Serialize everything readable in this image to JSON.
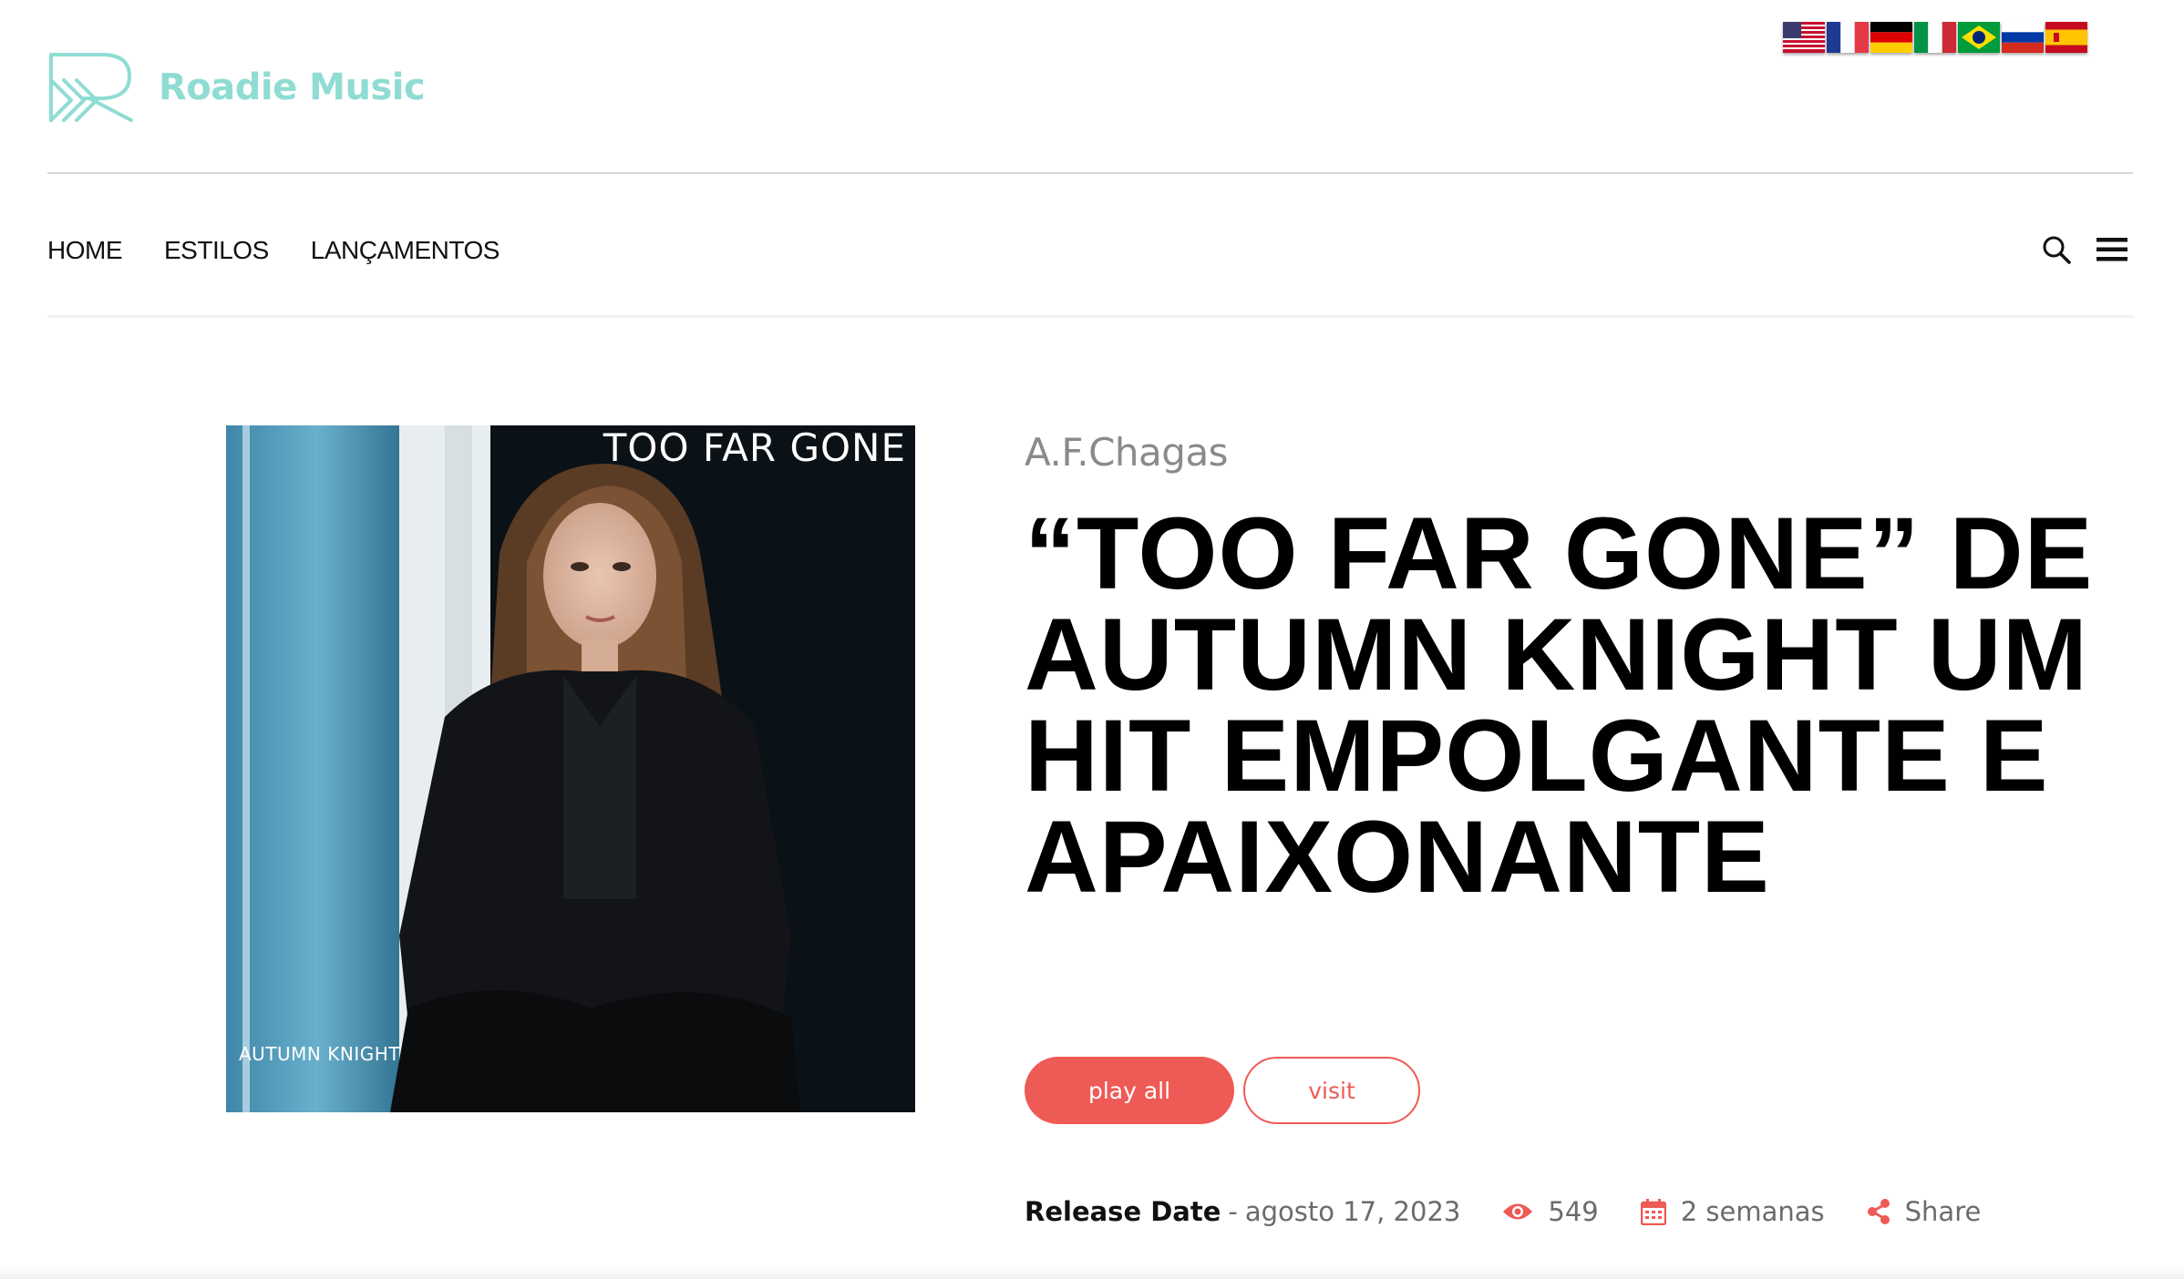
{
  "brand": {
    "name": "Roadie Music",
    "color": "#8fdcd3"
  },
  "languages": [
    {
      "code": "en",
      "icon": "us-flag-icon"
    },
    {
      "code": "fr",
      "icon": "france-flag-icon"
    },
    {
      "code": "de",
      "icon": "germany-flag-icon"
    },
    {
      "code": "it",
      "icon": "italy-flag-icon"
    },
    {
      "code": "pt",
      "icon": "brazil-flag-icon"
    },
    {
      "code": "ru",
      "icon": "russia-flag-icon"
    },
    {
      "code": "es",
      "icon": "spain-flag-icon"
    }
  ],
  "nav": {
    "items": [
      "HOME",
      "ESTILOS",
      "LANÇAMENTOS"
    ],
    "icons": [
      "search-icon",
      "hamburger-menu-icon"
    ]
  },
  "cover": {
    "title": "TOO FAR GONE",
    "artist": "AUTUMN KNIGHT"
  },
  "post": {
    "author": "A.F.Chagas",
    "title": "“TOO FAR GONE” DE AUTUMN KNIGHT UM HIT EMPOLGANTE E APAIXONANTE",
    "play_label": "play all",
    "visit_label": "visit",
    "release_label": "Release Date",
    "release_date": "agosto 17, 2023",
    "views": "549",
    "age": "2 semanas",
    "share_label": "Share"
  },
  "colors": {
    "accent": "#ee5a55",
    "text": "#111111",
    "muted": "#6b6b6b"
  }
}
